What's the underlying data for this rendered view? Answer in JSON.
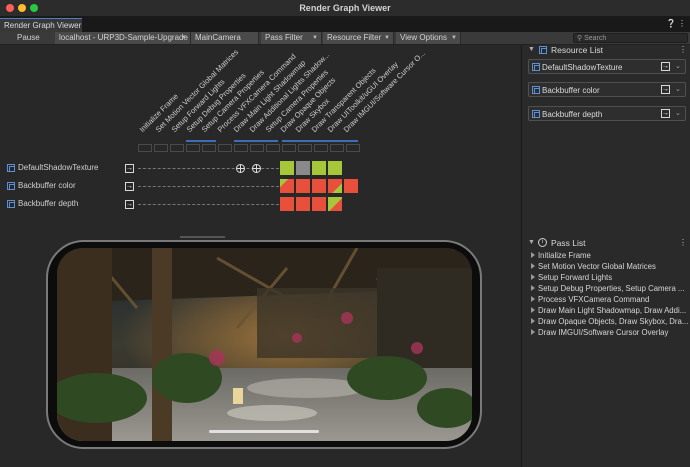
{
  "window": {
    "title": "Render Graph Viewer"
  },
  "tabs": [
    {
      "label": "Render Graph Viewer"
    }
  ],
  "toolbar": {
    "pause_label": "Pause",
    "target_value": "localhost - URP3D-Sample-Upgrade",
    "camera_value": "MainCamera",
    "pass_filter_label": "Pass Filter",
    "resource_filter_label": "Resource Filter",
    "view_options_label": "View Options",
    "search_placeholder": "Search"
  },
  "passes": [
    "Initialize Frame",
    "Set Motion Vector Global Matrices",
    "Setup Forward Lights",
    "Setup Debug Properties",
    "Setup Camera Properties",
    "Process VFXCamera Command",
    "Draw Main Light Shadowmap",
    "Draw Additional Lights Shadow...",
    "Setup Camera Properties",
    "Draw Opaque Objects",
    "Draw Skybox",
    "Draw Transparent Objects",
    "Draw UIToolkit/uGUI Overlay",
    "Draw IMGUI/Software Cursor O..."
  ],
  "resources": [
    {
      "name": "DefaultShadowTexture"
    },
    {
      "name": "Backbuffer color"
    },
    {
      "name": "Backbuffer depth"
    }
  ],
  "resource_list": {
    "title": "Resource List",
    "items": [
      {
        "label": "DefaultShadowTexture"
      },
      {
        "label": "Backbuffer color"
      },
      {
        "label": "Backbuffer depth"
      }
    ]
  },
  "pass_list": {
    "title": "Pass List",
    "items": [
      {
        "label": "Initialize Frame"
      },
      {
        "label": "Set Motion Vector Global Matrices"
      },
      {
        "label": "Setup Forward Lights"
      },
      {
        "label": "Setup Debug Properties, Setup Camera ..."
      },
      {
        "label": "Process VFXCamera Command"
      },
      {
        "label": "Draw Main Light Shadowmap, Draw Addi..."
      },
      {
        "label": "Draw Opaque Objects, Draw Skybox, Dra..."
      },
      {
        "label": "Draw IMGUI/Software Cursor Overlay"
      }
    ]
  },
  "icons": {
    "texture": "texture-icon",
    "import": "imported-resource-icon",
    "globe": "global-access-icon",
    "menu": "more-menu-icon",
    "chevron": "chevron-down-icon"
  },
  "colors": {
    "read": "#a7c73a",
    "write": "#e8503c",
    "grey": "#8a8a8a",
    "accent": "#3d6fb4"
  }
}
